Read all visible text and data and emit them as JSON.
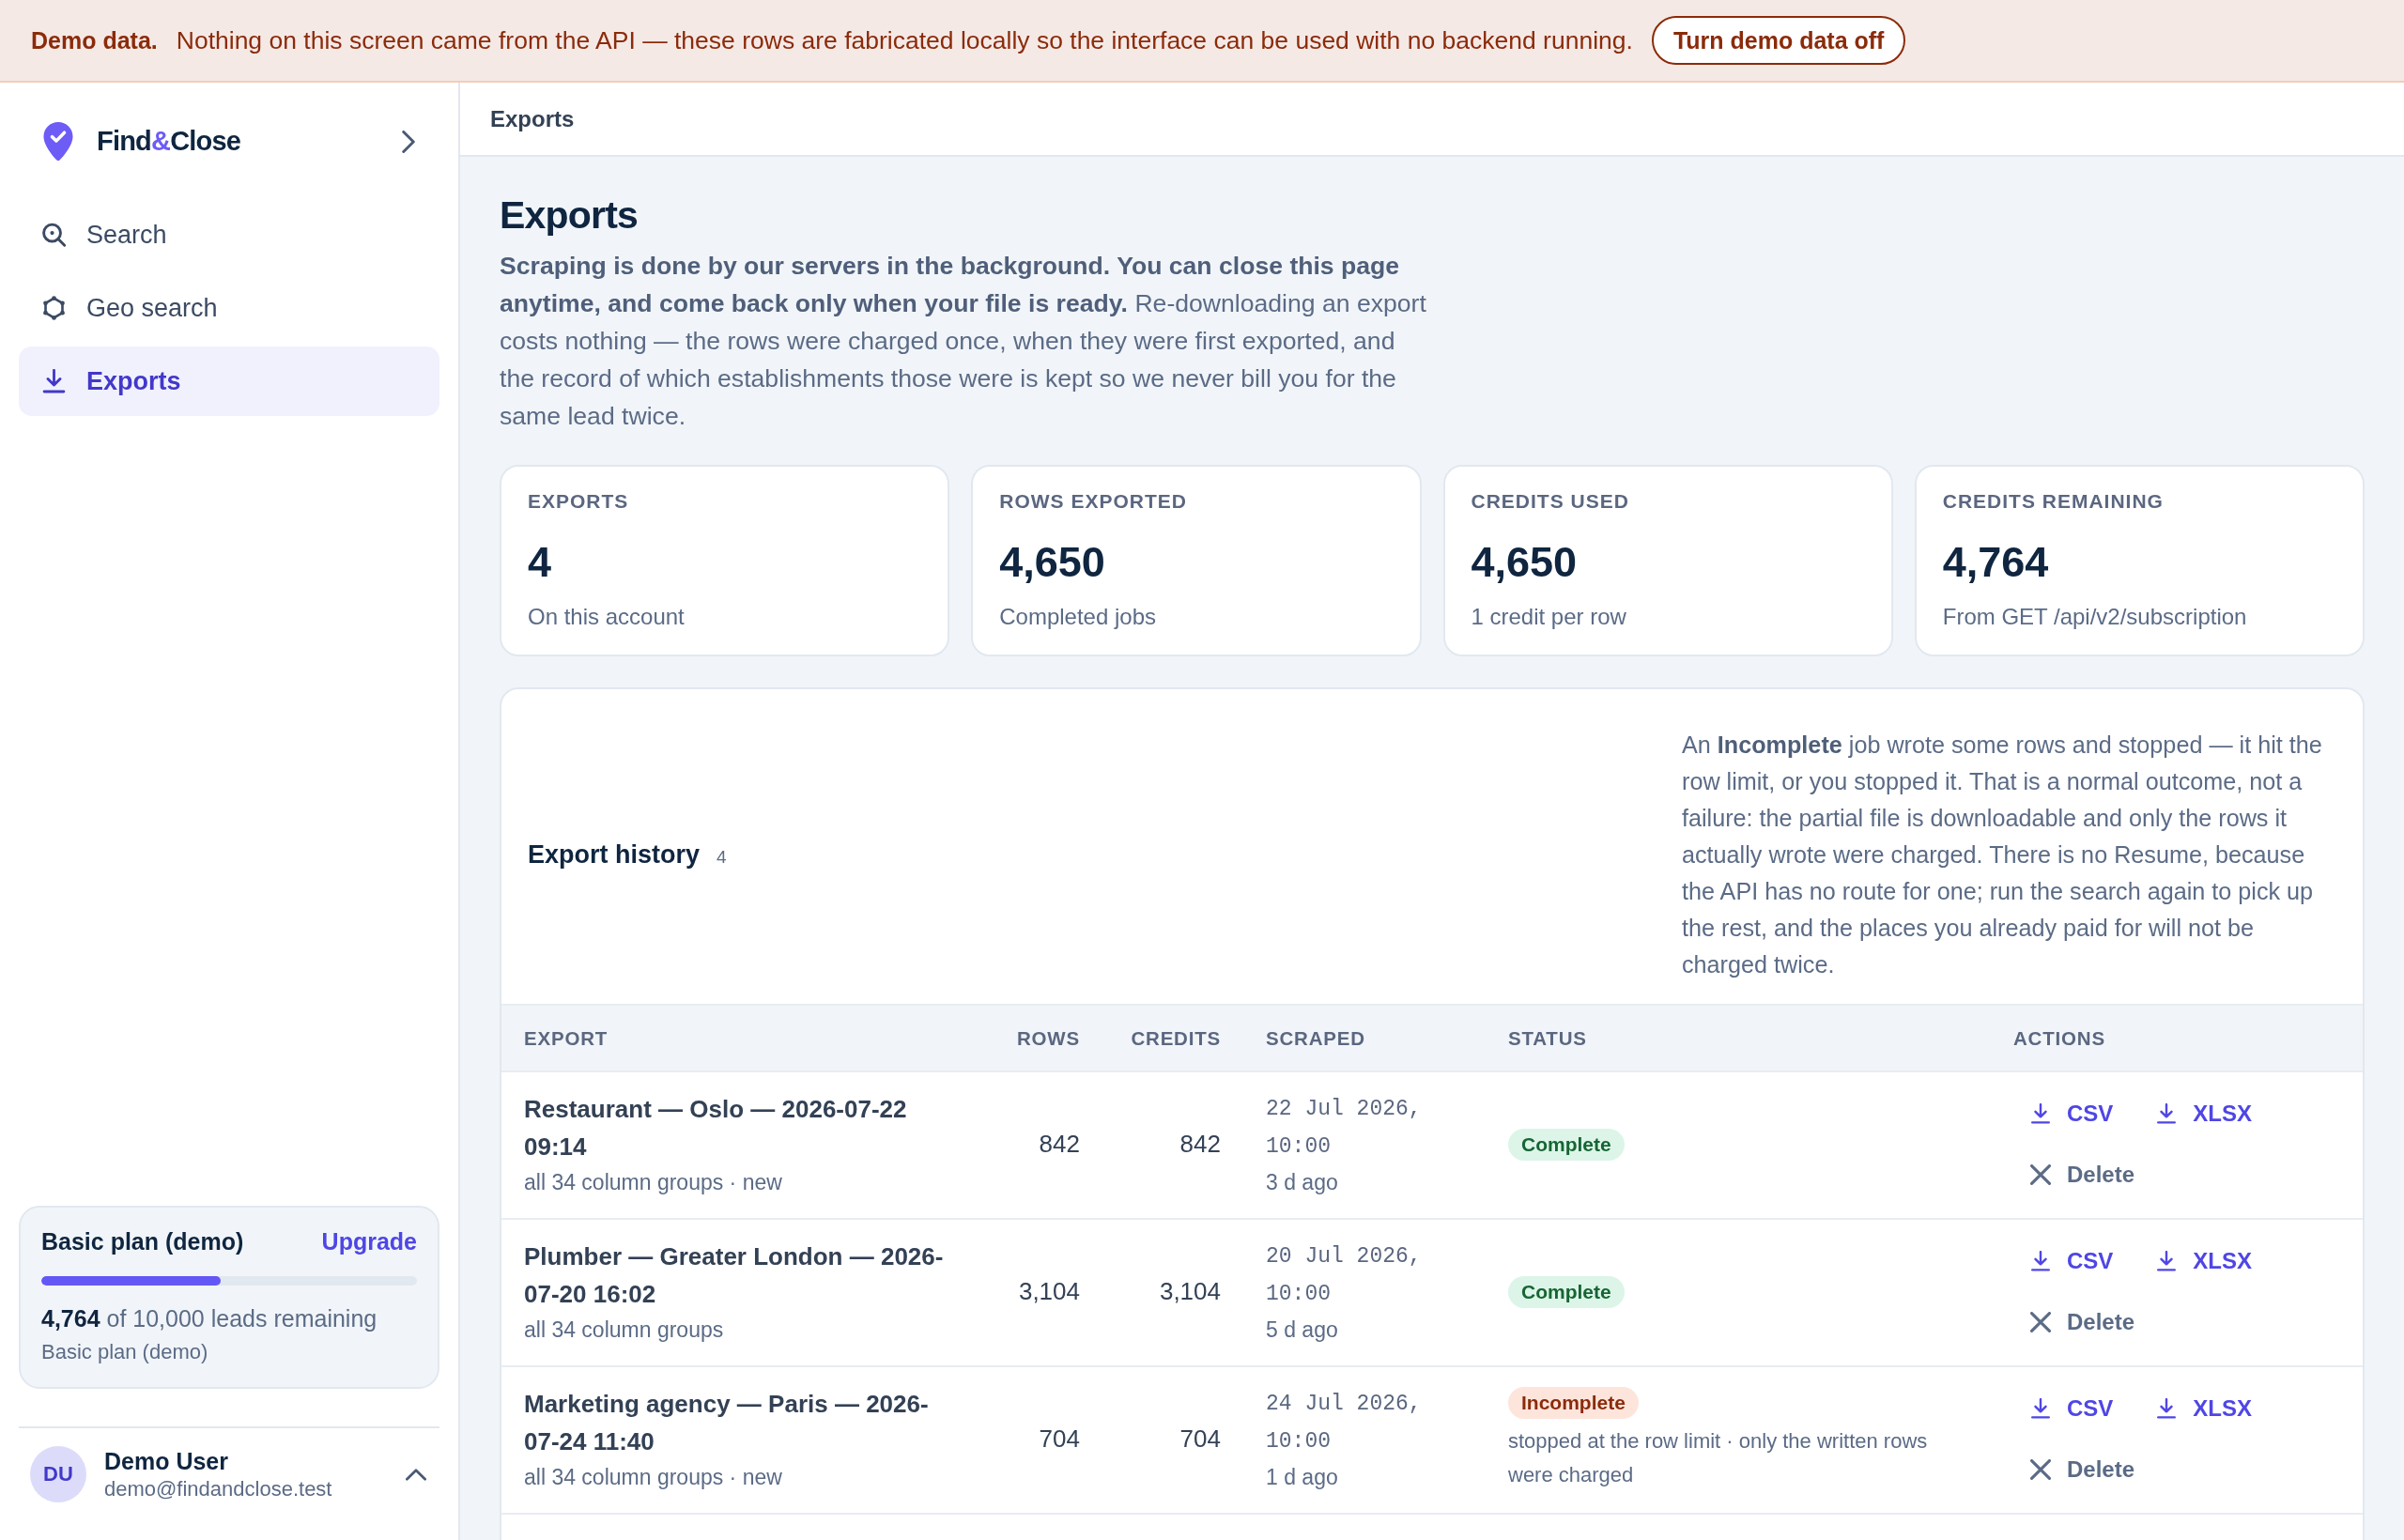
{
  "demo_banner": {
    "title": "Demo data.",
    "message": "Nothing on this screen came from the API — these rows are fabricated locally so the interface can be used with no backend running.",
    "button": "Turn demo data off"
  },
  "sidebar": {
    "brand": [
      {
        "text": "Find",
        "accent": false
      },
      {
        "text": "&",
        "accent": true
      },
      {
        "text": "Close",
        "accent": false
      }
    ],
    "items": [
      {
        "label": "Search",
        "kind": "search",
        "selected": false
      },
      {
        "label": "Geo search",
        "kind": "geo_search",
        "selected": false
      },
      {
        "label": "Exports",
        "kind": "exports",
        "selected": true
      }
    ],
    "plan": {
      "title": "Basic plan (demo)",
      "link": "Upgrade",
      "level": 0.4764,
      "remaining": "**4,764** of 10,000 leads remaining",
      "subtitle": "Basic plan (demo)"
    },
    "user": {
      "initials": "DU",
      "name": "Demo User",
      "email": "demo@findandclose.test"
    }
  },
  "header": {
    "breadcrumb": "Exports"
  },
  "page": {
    "title": "Exports",
    "description": "**Scraping is done by our servers in the background. You can close this page anytime, and come back only when your file is ready.** Re-downloading an export costs nothing — the rows were charged once, when they were first exported, and the record of which establishments those were is kept so we never bill you for the same lead twice."
  },
  "stats": [
    {
      "label": "EXPORTS",
      "value": "4",
      "note": "On this account"
    },
    {
      "label": "ROWS EXPORTED",
      "value": "4,650",
      "note": "Completed jobs"
    },
    {
      "label": "CREDITS USED",
      "value": "4,650",
      "note": "1 credit per row"
    },
    {
      "label": "CREDITS REMAINING",
      "value": "4,764",
      "note": "From GET /api/v2/subscription"
    }
  ],
  "history": {
    "title": "Export history",
    "count": "4",
    "note": "An **Incomplete** job wrote some rows and stopped — it hit the row limit, or you stopped it. That is a normal outcome, not a failure: the partial file is downloadable and only the rows it actually wrote were charged. There is no Resume, because the API has no route for one; run the search again to pick up the rest, and the places you already paid for will not be charged twice.",
    "table": {
      "columns": [
        "EXPORT",
        "ROWS",
        "CREDITS",
        "SCRAPED",
        "STATUS",
        "ACTIONS"
      ],
      "rows": [
        {
          "name": "Restaurant — Oslo — 2026-07-22 09:14",
          "detail": "all 34 column groups · new",
          "rows": "842",
          "credits": "842",
          "scraped": "22 Jul 2026, 10:00",
          "age": "3 d ago",
          "status": {
            "label": "Complete",
            "kind": "complete"
          },
          "actions": [
            {
              "label": "CSV",
              "kind": "download"
            },
            {
              "label": "XLSX",
              "kind": "download"
            },
            {
              "label": "Delete",
              "kind": "delete"
            }
          ]
        },
        {
          "name": "Plumber — Greater London — 2026-07-20 16:02",
          "detail": "all 34 column groups",
          "rows": "3,104",
          "credits": "3,104",
          "scraped": "20 Jul 2026, 10:00",
          "age": "5 d ago",
          "status": {
            "label": "Complete",
            "kind": "complete"
          },
          "actions": [
            {
              "label": "CSV",
              "kind": "download"
            },
            {
              "label": "XLSX",
              "kind": "download"
            },
            {
              "label": "Delete",
              "kind": "delete"
            }
          ]
        },
        {
          "name": "Marketing agency — Paris — 2026-07-24 11:40",
          "detail": "all 34 column groups · new",
          "rows": "704",
          "credits": "704",
          "scraped": "24 Jul 2026, 10:00",
          "age": "1 d ago",
          "status": {
            "label": "Incomplete",
            "kind": "incomplete",
            "note": "stopped at the row limit · only the written rows were charged"
          },
          "actions": [
            {
              "label": "CSV",
              "kind": "download"
            },
            {
              "label": "XLSX",
              "kind": "download"
            },
            {
              "label": "Delete",
              "kind": "delete"
            }
          ]
        }
      ]
    }
  }
}
